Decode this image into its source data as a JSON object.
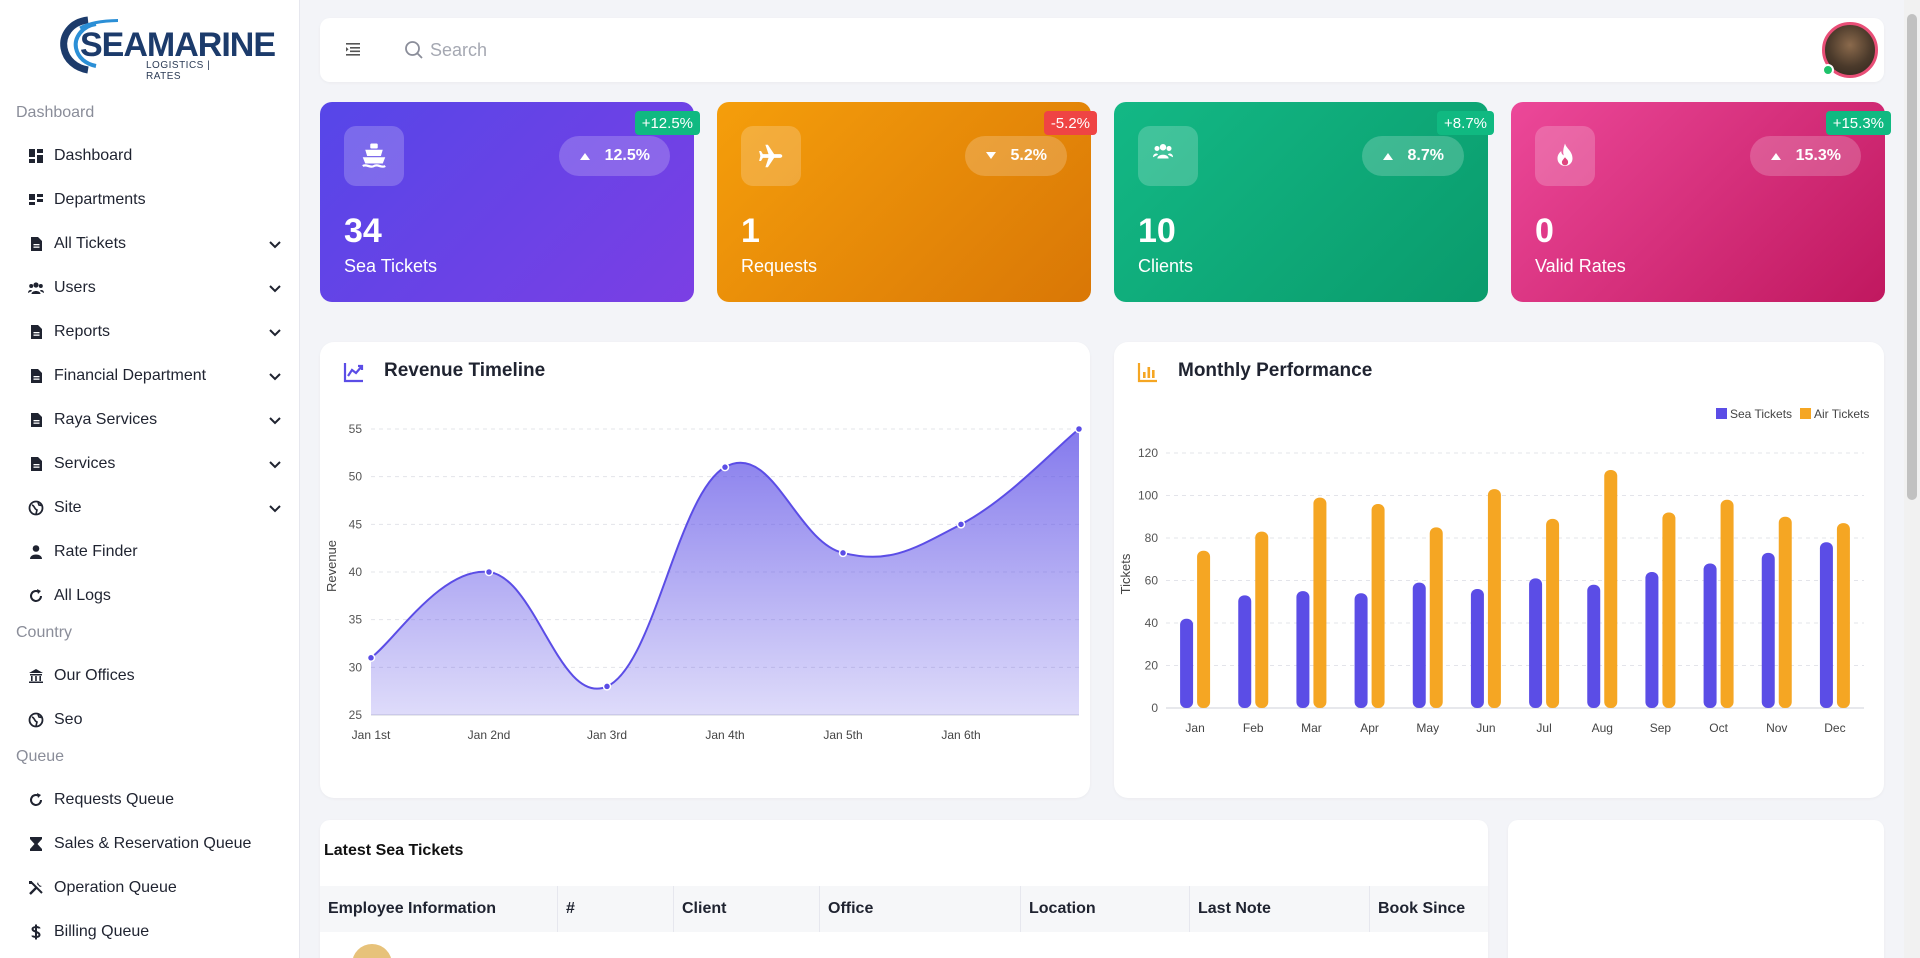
{
  "brand": {
    "name": "SEAMARINE",
    "tagline": "LOGISTICS | RATES"
  },
  "sidebar": {
    "sections": [
      {
        "title": "Dashboard",
        "items": [
          {
            "label": "Dashboard",
            "icon": "dashboard-icon",
            "expandable": false
          },
          {
            "label": "Departments",
            "icon": "departments-icon",
            "expandable": false
          },
          {
            "label": "All Tickets",
            "icon": "document-icon",
            "expandable": true
          },
          {
            "label": "Users",
            "icon": "users-icon",
            "expandable": true
          },
          {
            "label": "Reports",
            "icon": "document-icon",
            "expandable": true
          },
          {
            "label": "Financial Department",
            "icon": "document-icon",
            "expandable": true
          },
          {
            "label": "Raya Services",
            "icon": "document-icon",
            "expandable": true
          },
          {
            "label": "Services",
            "icon": "document-icon",
            "expandable": true
          },
          {
            "label": "Site",
            "icon": "globe-icon",
            "expandable": true
          },
          {
            "label": "Rate Finder",
            "icon": "user-icon",
            "expandable": false
          },
          {
            "label": "All Logs",
            "icon": "refresh-icon",
            "expandable": false
          }
        ]
      },
      {
        "title": "Country",
        "items": [
          {
            "label": "Our Offices",
            "icon": "building-icon",
            "expandable": false
          },
          {
            "label": "Seo",
            "icon": "globe-icon",
            "expandable": false
          }
        ]
      },
      {
        "title": "Queue",
        "items": [
          {
            "label": "Requests Queue",
            "icon": "refresh-icon",
            "expandable": false
          },
          {
            "label": "Sales & Reservation Queue",
            "icon": "hourglass-icon",
            "expandable": false
          },
          {
            "label": "Operation Queue",
            "icon": "tools-icon",
            "expandable": false
          },
          {
            "label": "Billing Queue",
            "icon": "dollar-icon",
            "expandable": false
          }
        ]
      }
    ]
  },
  "topbar": {
    "search_placeholder": "Search"
  },
  "stats": [
    {
      "value": "34",
      "label": "Sea Tickets",
      "change": "12.5%",
      "direction": "up",
      "badge": "+12.5%",
      "icon": "ship-icon",
      "gradient": [
        "#5646e8",
        "#7b3fe4"
      ],
      "badge_color": "#10b981"
    },
    {
      "value": "1",
      "label": "Requests",
      "change": "5.2%",
      "direction": "down",
      "badge": "-5.2%",
      "icon": "plane-icon",
      "gradient": [
        "#f59e0b",
        "#d97706"
      ],
      "badge_color": "#ef4444"
    },
    {
      "value": "10",
      "label": "Clients",
      "change": "8.7%",
      "direction": "up",
      "badge": "+8.7%",
      "icon": "users-icon",
      "gradient": [
        "#13b885",
        "#0a9b6c"
      ],
      "badge_color": "#10b981"
    },
    {
      "value": "0",
      "label": "Valid Rates",
      "change": "15.3%",
      "direction": "up",
      "badge": "+15.3%",
      "icon": "fire-icon",
      "gradient": [
        "#ec4899",
        "#c0185f"
      ],
      "badge_color": "#10b981"
    }
  ],
  "revenue_panel": {
    "title": "Revenue Timeline"
  },
  "performance_panel": {
    "title": "Monthly Performance"
  },
  "chart_data": [
    {
      "type": "area",
      "title": "Revenue Timeline",
      "ylabel": "Revenue",
      "xlabel": "",
      "x": [
        "Jan 1st",
        "Jan 2nd",
        "Jan 3rd",
        "Jan 4th",
        "Jan 5th",
        "Jan 6th",
        ""
      ],
      "series": [
        {
          "values": [
            31,
            40,
            28,
            51,
            42,
            45,
            55
          ]
        }
      ],
      "yticks": [
        25,
        30,
        35,
        40,
        45,
        50,
        55
      ],
      "ylim": [
        25,
        55
      ],
      "color": "#5b4de6"
    },
    {
      "type": "bar",
      "title": "Monthly Performance",
      "ylabel": "Tickets",
      "xlabel": "",
      "categories": [
        "Jan",
        "Feb",
        "Mar",
        "Apr",
        "May",
        "Jun",
        "Jul",
        "Aug",
        "Sep",
        "Oct",
        "Nov",
        "Dec"
      ],
      "series": [
        {
          "name": "Sea Tickets",
          "color": "#5b4de6",
          "values": [
            42,
            53,
            55,
            54,
            59,
            56,
            61,
            58,
            64,
            68,
            73,
            78
          ]
        },
        {
          "name": "Air Tickets",
          "color": "#f5a623",
          "values": [
            74,
            83,
            99,
            96,
            85,
            103,
            89,
            112,
            92,
            98,
            90,
            87
          ]
        }
      ],
      "yticks": [
        0,
        20,
        40,
        60,
        80,
        100,
        120
      ],
      "ylim": [
        0,
        120
      ],
      "legend": "top-right"
    }
  ],
  "table": {
    "title": "Latest Sea Tickets",
    "columns": [
      "Employee Information",
      "#",
      "Client",
      "Office",
      "Location",
      "Last Note",
      "Book Since"
    ]
  }
}
